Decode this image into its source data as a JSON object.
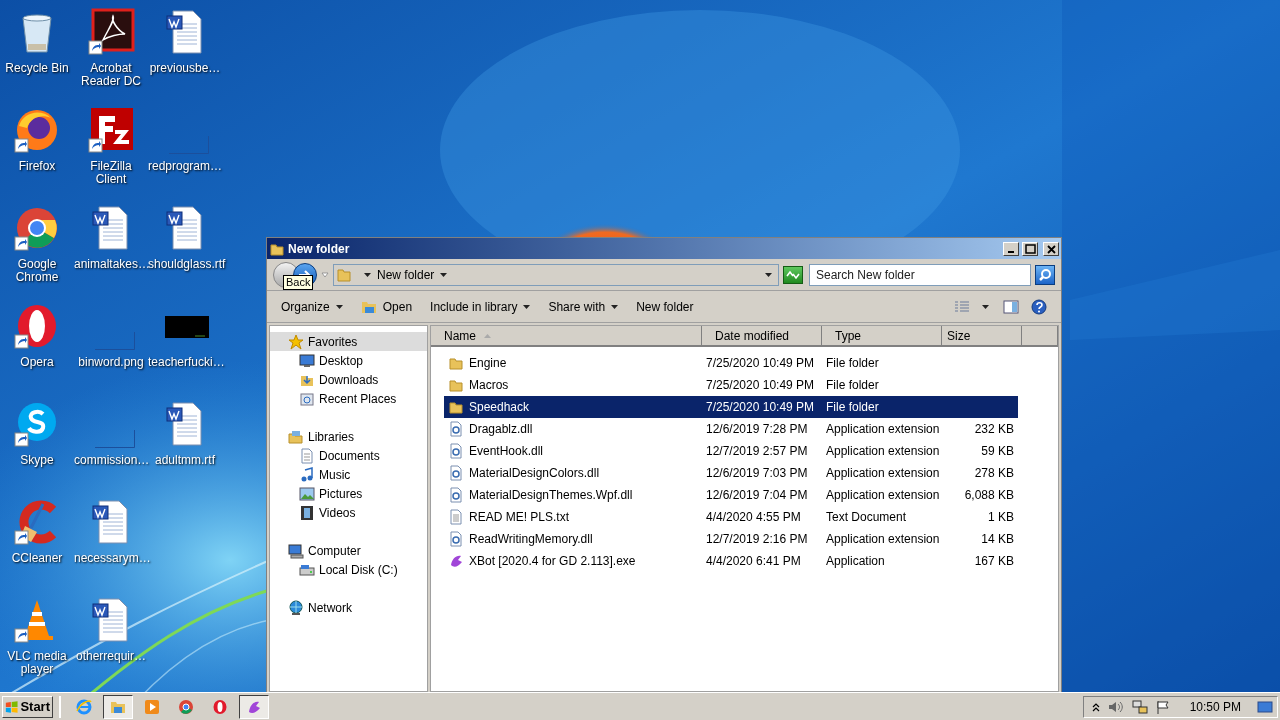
{
  "desktop": {
    "rows": [
      [
        {
          "label": "Recycle Bin",
          "kind": "recycle",
          "shortcut": false
        },
        {
          "label": "Acrobat Reader DC",
          "kind": "acrobat",
          "shortcut": true
        },
        {
          "label": "previousbe…",
          "kind": "word",
          "shortcut": false
        }
      ],
      [
        {
          "label": "Firefox",
          "kind": "firefox",
          "shortcut": true
        },
        {
          "label": "FileZilla Client",
          "kind": "filezilla",
          "shortcut": true
        },
        {
          "label": "redprogram…",
          "kind": "blank",
          "shortcut": false
        }
      ],
      [
        {
          "label": "Google Chrome",
          "kind": "chrome",
          "shortcut": true
        },
        {
          "label": "animaltakes…",
          "kind": "word",
          "shortcut": false
        },
        {
          "label": "shouldglass.rtf",
          "kind": "word",
          "shortcut": false
        }
      ],
      [
        {
          "label": "Opera",
          "kind": "opera",
          "shortcut": true
        },
        {
          "label": "binword.png",
          "kind": "blank",
          "shortcut": false
        },
        {
          "label": "teacherfucki…",
          "kind": "dark",
          "shortcut": false
        }
      ],
      [
        {
          "label": "Skype",
          "kind": "skype",
          "shortcut": true
        },
        {
          "label": "commission…",
          "kind": "blank",
          "shortcut": false
        },
        {
          "label": "adultmm.rtf",
          "kind": "word",
          "shortcut": false
        }
      ],
      [
        {
          "label": "CCleaner",
          "kind": "ccleaner",
          "shortcut": true
        },
        {
          "label": "necessarym…",
          "kind": "word",
          "shortcut": false
        }
      ],
      [
        {
          "label": "VLC media player",
          "kind": "vlc",
          "shortcut": true
        },
        {
          "label": "otherrequir…",
          "kind": "word",
          "shortcut": false
        }
      ]
    ]
  },
  "window": {
    "title": "New folder",
    "address": "New folder",
    "tooltip": "Back",
    "search": {
      "placeholder": "Search New folder"
    },
    "toolbar": [
      {
        "label": "Organize",
        "kind": "menu"
      },
      {
        "label": "Open",
        "kind": "open"
      },
      {
        "label": "Include in library",
        "kind": "menu"
      },
      {
        "label": "Share with",
        "kind": "menu"
      },
      {
        "label": "New folder",
        "kind": "plain"
      }
    ],
    "nav": [
      {
        "label": "Favorites",
        "kind": "star",
        "selected": true,
        "children": [
          {
            "label": "Desktop",
            "kind": "desktop",
            "selected": false
          },
          {
            "label": "Downloads",
            "kind": "downloads",
            "selected": false
          },
          {
            "label": "Recent Places",
            "kind": "recent",
            "selected": false
          }
        ]
      },
      {
        "label": "Libraries",
        "kind": "library",
        "selected": false,
        "children": [
          {
            "label": "Documents",
            "kind": "documents",
            "selected": false
          },
          {
            "label": "Music",
            "kind": "music",
            "selected": false
          },
          {
            "label": "Pictures",
            "kind": "pictures",
            "selected": false
          },
          {
            "label": "Videos",
            "kind": "videos",
            "selected": false
          }
        ]
      },
      {
        "label": "Computer",
        "kind": "computer",
        "selected": false,
        "children": [
          {
            "label": "Local Disk (C:)",
            "kind": "disk",
            "selected": false
          }
        ]
      },
      {
        "label": "Network",
        "kind": "network",
        "selected": false
      }
    ],
    "columns": [
      "Name",
      "Date modified",
      "Type",
      "Size"
    ],
    "files": [
      {
        "name": "Engine",
        "date": "7/25/2020 10:49 PM",
        "type": "File folder",
        "kind": "folder",
        "selected": false
      },
      {
        "name": "Macros",
        "date": "7/25/2020 10:49 PM",
        "type": "File folder",
        "kind": "folder",
        "selected": false
      },
      {
        "name": "Speedhack",
        "date": "7/25/2020 10:49 PM",
        "type": "File folder",
        "kind": "folder",
        "selected": true
      },
      {
        "name": "Dragablz.dll",
        "date": "12/6/2019 7:28 PM",
        "type": "Application extension",
        "size": "232 KB",
        "kind": "dll",
        "selected": false
      },
      {
        "name": "EventHook.dll",
        "date": "12/7/2019 2:57 PM",
        "type": "Application extension",
        "size": "59 KB",
        "kind": "dll",
        "selected": false
      },
      {
        "name": "MaterialDesignColors.dll",
        "date": "12/6/2019 7:03 PM",
        "type": "Application extension",
        "size": "278 KB",
        "kind": "dll",
        "selected": false
      },
      {
        "name": "MaterialDesignThemes.Wpf.dll",
        "date": "12/6/2019 7:04 PM",
        "type": "Application extension",
        "size": "6,088 KB",
        "kind": "dll",
        "selected": false
      },
      {
        "name": "READ ME! PLS.txt",
        "date": "4/4/2020 4:55 PM",
        "type": "Text Document",
        "size": "1 KB",
        "kind": "txt",
        "selected": false
      },
      {
        "name": "ReadWritingMemory.dll",
        "date": "12/7/2019 2:16 PM",
        "type": "Application extension",
        "size": "14 KB",
        "kind": "dll",
        "selected": false
      },
      {
        "name": "XBot [2020.4 for GD 2.113].exe",
        "date": "4/4/2020 6:41 PM",
        "type": "Application",
        "size": "167 KB",
        "kind": "exe",
        "selected": false
      }
    ]
  },
  "taskbar": {
    "start": "Start",
    "apps": [
      {
        "kind": "ie",
        "active": false
      },
      {
        "kind": "explorer",
        "active": true
      },
      {
        "kind": "media",
        "active": false
      },
      {
        "kind": "chrome",
        "active": false
      },
      {
        "kind": "opera",
        "active": false
      },
      {
        "kind": "xbot",
        "active": true
      }
    ],
    "clock": "10:50 PM"
  }
}
